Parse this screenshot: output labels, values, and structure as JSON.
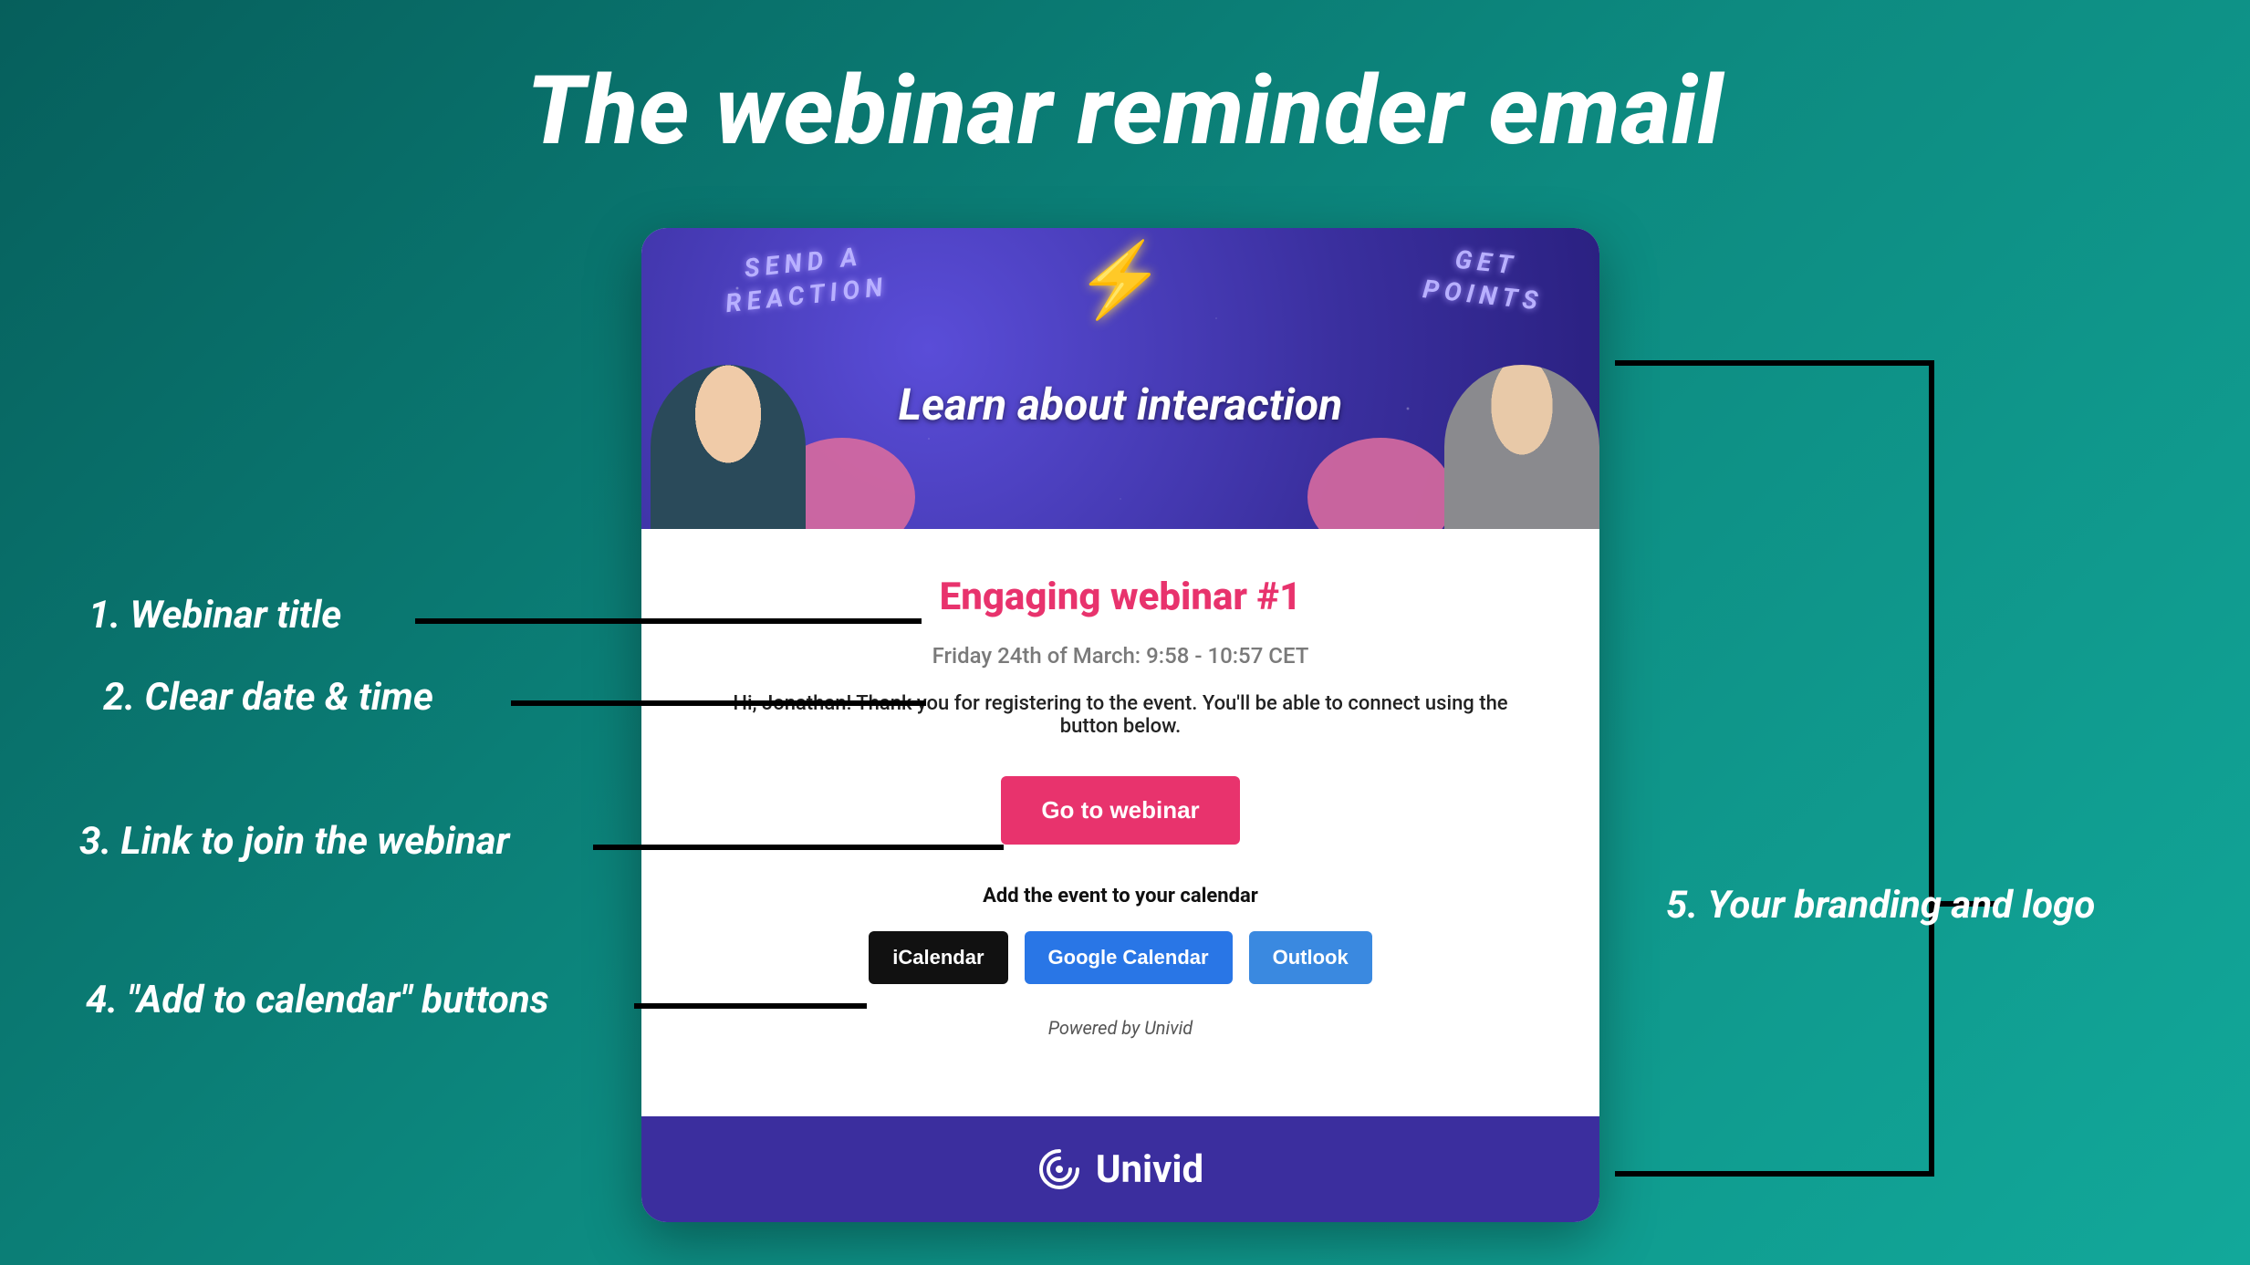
{
  "slide": {
    "title": "The webinar reminder email"
  },
  "email": {
    "header": {
      "neon_left_line1": "SEND A",
      "neon_left_line2": "REACTION",
      "neon_right_line1": "GET",
      "neon_right_line2": "POINTS",
      "tagline": "Learn about interaction"
    },
    "body": {
      "title": "Engaging webinar #1",
      "datetime": "Friday 24th of March: 9:58 - 10:57 CET",
      "greeting": "Hi, Jonathan! Thank you for registering to the event. You'll be able to connect using the button below.",
      "cta": "Go to webinar",
      "add_calendar_label": "Add the event to your calendar",
      "buttons": {
        "ical": "iCalendar",
        "google": "Google Calendar",
        "outlook": "Outlook"
      },
      "powered": "Powered by Univid"
    },
    "footer": {
      "brand": "Univid"
    }
  },
  "annotations": {
    "a1": "1. Webinar title",
    "a2": "2. Clear date & time",
    "a3": "3. Link to join the webinar",
    "a4": "4. \"Add to calendar\" buttons",
    "a5": "5. Your branding and logo"
  },
  "colors": {
    "accent_pink": "#e8336d",
    "brand_purple": "#3b2e9e",
    "button_blue": "#2976e6"
  }
}
